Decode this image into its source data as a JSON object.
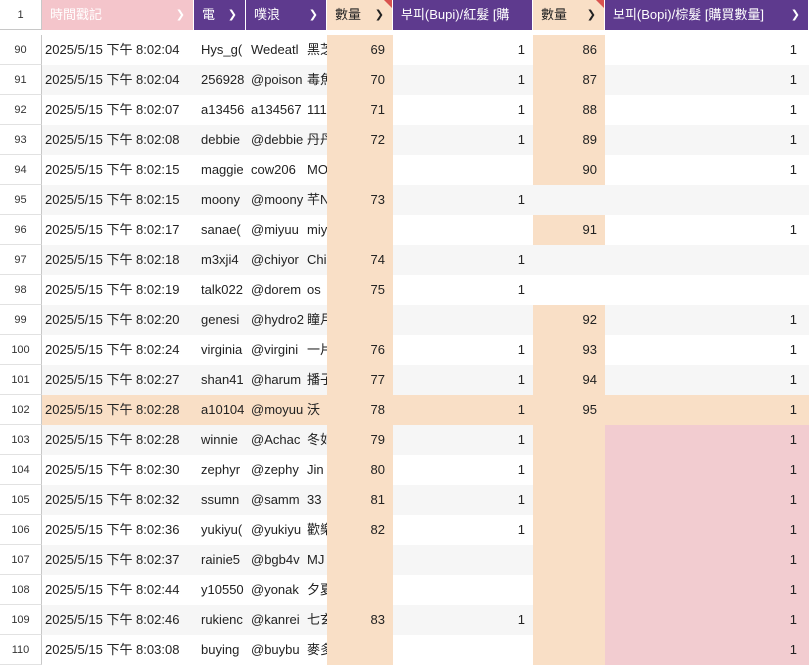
{
  "header": {
    "row_number": "1",
    "col_timestamp": "時間戳記",
    "col_b": "電",
    "col_c": "噗浪",
    "col_qty1": "數量",
    "col_bupi": "부피(Bupi)/紅髮 [購",
    "col_qty2": "數量",
    "col_bopi": "보피(Bopi)/棕髮 [購買數量]"
  },
  "colors": {
    "purple_header": "#5e3a8e",
    "pink_header": "#f4c5cb",
    "peach": "#f9dfc6",
    "pink_fill": "#f2ccd0",
    "light_row": "#f6f6f6"
  },
  "rows": [
    {
      "n": "90",
      "ts": "2025/5/15 下午 8:02:04",
      "b": "Hys_g(",
      "c": "Wedeatl",
      "d": "黑芝",
      "q1": "69",
      "bupi": "1",
      "q2": "86",
      "bopi": "1"
    },
    {
      "n": "91",
      "ts": "2025/5/15 下午 8:02:04",
      "b": "256928",
      "c": "@poison",
      "d": "毒魚",
      "q1": "70",
      "bupi": "1",
      "q2": "87",
      "bopi": "1"
    },
    {
      "n": "92",
      "ts": "2025/5/15 下午 8:02:07",
      "b": "a13456",
      "c": "a134567",
      "d": "111",
      "q1": "71",
      "bupi": "1",
      "q2": "88",
      "bopi": "1"
    },
    {
      "n": "93",
      "ts": "2025/5/15 下午 8:02:08",
      "b": "debbie",
      "c": "@debbie",
      "d": "丹丹",
      "q1": "72",
      "bupi": "1",
      "q2": "89",
      "bopi": "1"
    },
    {
      "n": "94",
      "ts": "2025/5/15 下午 8:02:15",
      "b": "maggie",
      "c": "cow206",
      "d": "MO",
      "q1": "",
      "bupi": "",
      "q2": "90",
      "bopi": "1"
    },
    {
      "n": "95",
      "ts": "2025/5/15 下午 8:02:15",
      "b": "moony",
      "c": "@moony",
      "d": "芊N",
      "q1": "73",
      "bupi": "1",
      "q2": "",
      "bopi": ""
    },
    {
      "n": "96",
      "ts": "2025/5/15 下午 8:02:17",
      "b": "sanae(",
      "c": "@miyuu",
      "d": "miy",
      "q1": "",
      "bupi": "",
      "q2": "91",
      "bopi": "1"
    },
    {
      "n": "97",
      "ts": "2025/5/15 下午 8:02:18",
      "b": "m3xji4",
      "c": "@chiyor",
      "d": "Chi",
      "q1": "74",
      "bupi": "1",
      "q2": "",
      "bopi": ""
    },
    {
      "n": "98",
      "ts": "2025/5/15 下午 8:02:19",
      "b": "talk022",
      "c": "@dorem",
      "d": "os",
      "q1": "75",
      "bupi": "1",
      "q2": "",
      "bopi": ""
    },
    {
      "n": "99",
      "ts": "2025/5/15 下午 8:02:20",
      "b": "genesi",
      "c": "@hydro2",
      "d": "瞳月",
      "q1": "",
      "bupi": "",
      "q2": "92",
      "bopi": "1"
    },
    {
      "n": "100",
      "ts": "2025/5/15 下午 8:02:24",
      "b": "virginia",
      "c": "@virgini",
      "d": "一片",
      "q1": "76",
      "bupi": "1",
      "q2": "93",
      "bopi": "1"
    },
    {
      "n": "101",
      "ts": "2025/5/15 下午 8:02:27",
      "b": "shan41",
      "c": "@harum",
      "d": "播子",
      "q1": "77",
      "bupi": "1",
      "q2": "94",
      "bopi": "1"
    },
    {
      "n": "102",
      "ts": "2025/5/15 下午 8:02:28",
      "b": "a10104",
      "c": "@moyuu",
      "d": "沃",
      "q1": "78",
      "bupi": "1",
      "q2": "95",
      "bopi": "1"
    },
    {
      "n": "103",
      "ts": "2025/5/15 下午 8:02:28",
      "b": "winnie",
      "c": "@Achac",
      "d": "冬如",
      "q1": "79",
      "bupi": "1",
      "q2": "",
      "bopi": "1"
    },
    {
      "n": "104",
      "ts": "2025/5/15 下午 8:02:30",
      "b": "zephyr",
      "c": "@zephy",
      "d": "Jin",
      "q1": "80",
      "bupi": "1",
      "q2": "",
      "bopi": "1"
    },
    {
      "n": "105",
      "ts": "2025/5/15 下午 8:02:32",
      "b": "ssumn",
      "c": "@samm",
      "d": "33",
      "q1": "81",
      "bupi": "1",
      "q2": "",
      "bopi": "1"
    },
    {
      "n": "106",
      "ts": "2025/5/15 下午 8:02:36",
      "b": "yukiyu(",
      "c": "@yukiyu",
      "d": "歡樂",
      "q1": "82",
      "bupi": "1",
      "q2": "",
      "bopi": "1"
    },
    {
      "n": "107",
      "ts": "2025/5/15 下午 8:02:37",
      "b": "rainie5",
      "c": "@bgb4v",
      "d": "MJ",
      "q1": "",
      "bupi": "",
      "q2": "",
      "bopi": "1"
    },
    {
      "n": "108",
      "ts": "2025/5/15 下午 8:02:44",
      "b": "y10550",
      "c": "@yonak",
      "d": "夕夏",
      "q1": "",
      "bupi": "",
      "q2": "",
      "bopi": "1"
    },
    {
      "n": "109",
      "ts": "2025/5/15 下午 8:02:46",
      "b": "rukienc",
      "c": "@kanrei",
      "d": "七玄",
      "q1": "83",
      "bupi": "1",
      "q2": "",
      "bopi": "1"
    },
    {
      "n": "110",
      "ts": "2025/5/15 下午 8:03:08",
      "b": "buying",
      "c": "@buybu",
      "d": "麥多",
      "q1": "",
      "bupi": "",
      "q2": "",
      "bopi": "1"
    }
  ]
}
